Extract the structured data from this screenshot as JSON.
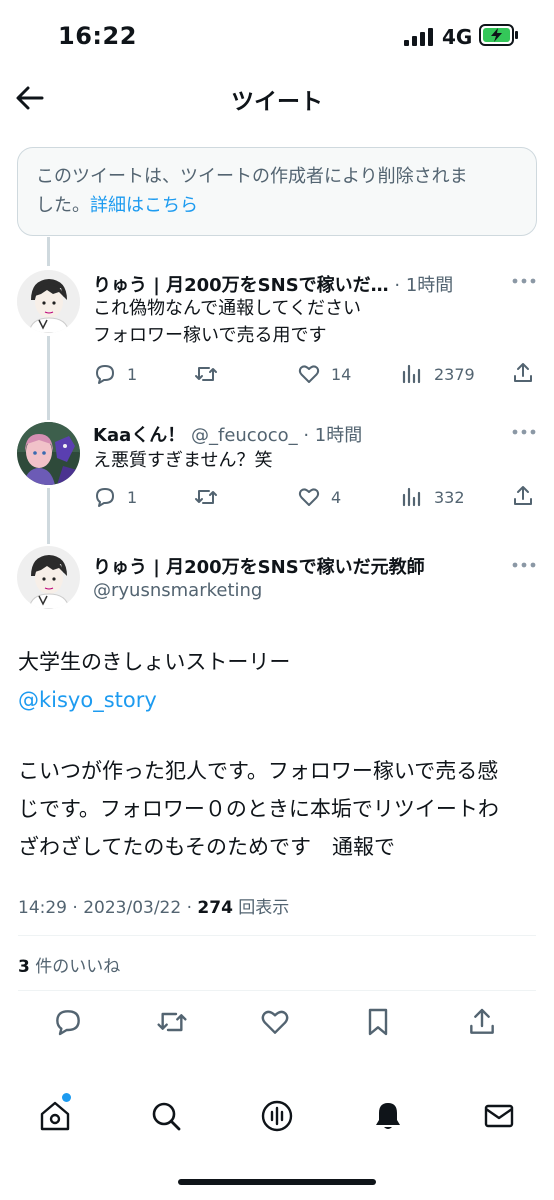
{
  "status_bar": {
    "time": "16:22",
    "network": "4G"
  },
  "header": {
    "title": "ツイート"
  },
  "deleted_notice": {
    "line1": "このツイートは、ツイートの作成者により削除されま",
    "line2_prefix": "した。",
    "link": "詳細はこちら"
  },
  "replies": [
    {
      "name": "りゅう | 月200万をSNSで稼いだ…",
      "meta": "· 1時間",
      "lines": [
        "これ偽物なんで通報してください",
        "フォロワー稼いで売る用です"
      ],
      "replies": "1",
      "retweets": "",
      "likes": "14",
      "views": "2379"
    },
    {
      "name": "Kaaくん！",
      "meta": "@_feucoco_ · 1時間",
      "lines": [
        "え悪質すぎません？笑"
      ],
      "replies": "1",
      "retweets": "",
      "likes": "4",
      "views": "332"
    }
  ],
  "main_tweet": {
    "name": "りゅう | 月200万をSNSで稼いだ元教師",
    "handle": "@ryusnsmarketing",
    "line1": "大学生のきしょいストーリー",
    "mention": "@kisyo_story",
    "para_lines": [
      "こいつが作った犯人です。フォロワー稼いで売る感",
      "じです。フォロワー０のときに本垢でリツイートわ",
      "ざわざしてたのもそのためです　通報で"
    ],
    "time": "14:29 · 2023/03/22 · ",
    "views_count": "274",
    "views_label": " 回表示",
    "likes_count": "3",
    "likes_label": " 件のいいね"
  },
  "icons": {
    "back": "arrow-left-icon",
    "reply": "reply-icon",
    "retweet": "retweet-icon",
    "like": "heart-icon",
    "views": "analytics-icon",
    "share": "share-icon",
    "bookmark": "bookmark-icon",
    "home": "home-icon",
    "search": "search-icon",
    "spaces": "spaces-icon",
    "notifications": "bell-icon",
    "messages": "mail-icon"
  },
  "colors": {
    "accent": "#1d9bf0",
    "secondary_text": "#536471",
    "battery_green": "#34c759"
  }
}
